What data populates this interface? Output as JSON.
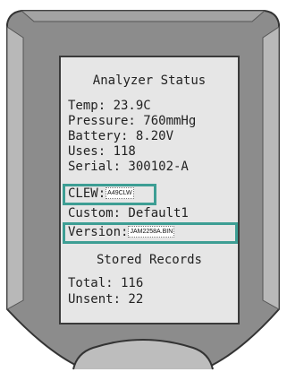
{
  "screen": {
    "title": "Analyzer Status",
    "temp": "Temp: 23.9C",
    "pressure": "Pressure: 760mmHg",
    "battery": "Battery:  8.20V",
    "uses": "Uses: 118",
    "serial": "Serial: 300102-A",
    "clew_label": "CLEW:",
    "clew_value": "A49CLW",
    "custom": "Custom: Default1",
    "version_label": "Version:",
    "version_value": "JAM2258A.BIN",
    "section_title": "Stored Records",
    "total": "Total: 116",
    "unsent": "Unsent: 22"
  },
  "colors": {
    "highlight": "#3d9e94",
    "screen_background": "#e6e6e6",
    "device_body": "#8c8c8c"
  }
}
